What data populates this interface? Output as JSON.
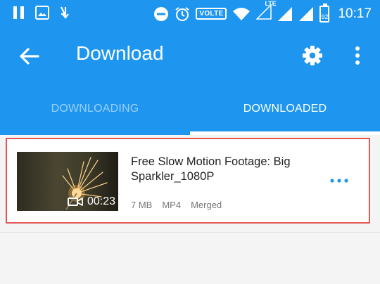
{
  "status_bar": {
    "time": "10:17",
    "volte": "VOLTE",
    "lte": "LTE",
    "battery": "92",
    "icons": [
      "pause-icon",
      "image-icon",
      "download-notify-icon",
      "dnd-icon",
      "alarm-icon",
      "wifi-icon",
      "signal-icon",
      "battery-icon"
    ]
  },
  "toolbar": {
    "title": "Download",
    "back_icon": "arrow-left-icon",
    "settings_icon": "gear-icon",
    "menu_icon": "more-vert-icon"
  },
  "tabs": [
    {
      "label": "DOWNLOADING",
      "active": false
    },
    {
      "label": "DOWNLOADED",
      "active": true
    }
  ],
  "downloads": [
    {
      "name": "Free Slow Motion Footage: Big Sparkler_1080P",
      "duration": "00:23",
      "size": "7 MB",
      "format": "MP4",
      "status": "Merged"
    }
  ],
  "colors": {
    "primary": "#1e96ef",
    "highlight_border": "#e35757",
    "more_dots": "#1e96ef"
  }
}
